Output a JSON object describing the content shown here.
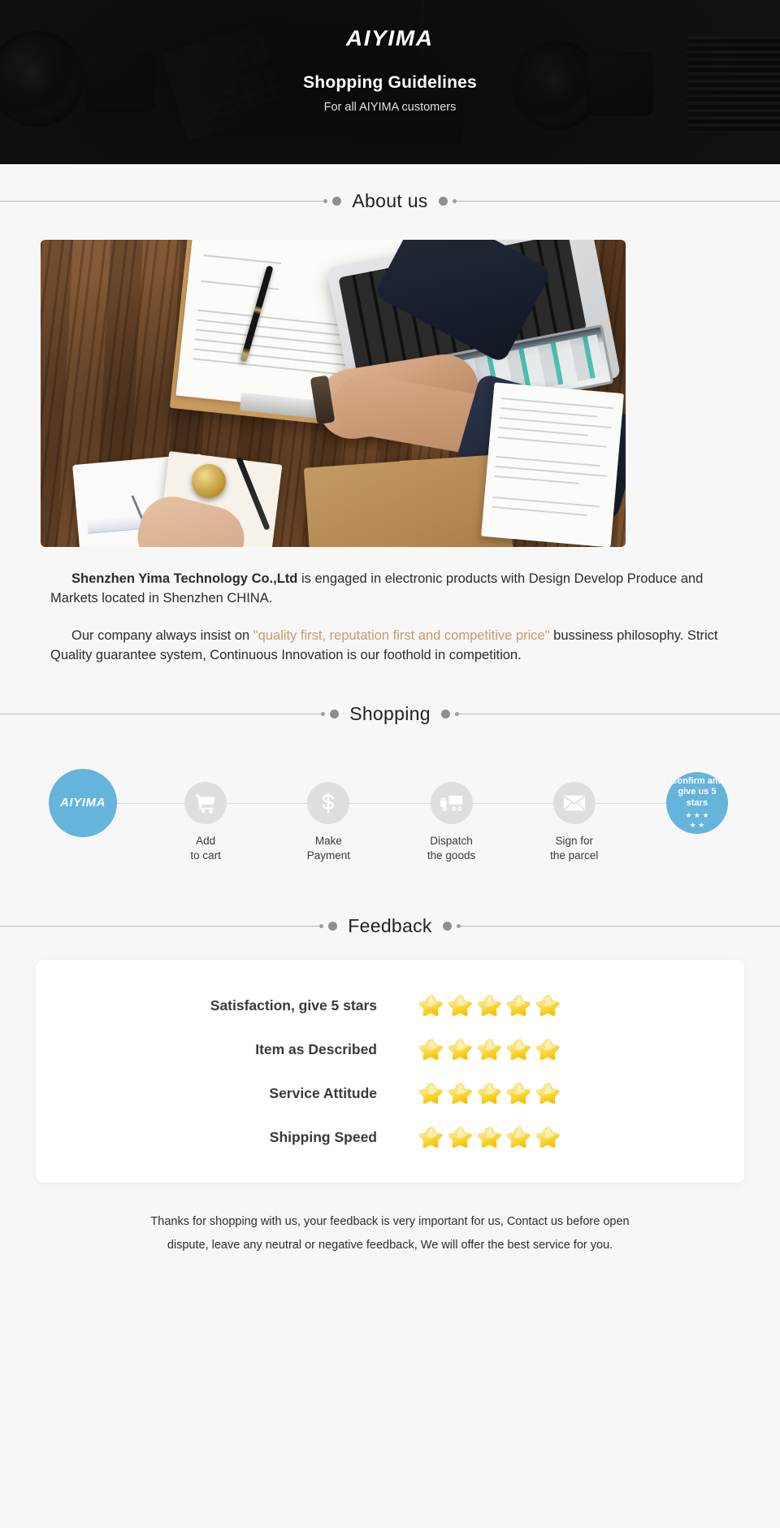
{
  "hero": {
    "brand": "AIYIMA",
    "title": "Shopping Guidelines",
    "subtitle": "For all AIYIMA customers"
  },
  "sections": {
    "about_title": "About us",
    "shopping_title": "Shopping",
    "feedback_title": "Feedback"
  },
  "about": {
    "para1_lead": "Shenzhen Yima Technology Co.,Ltd",
    "para1_rest": " is engaged in electronic products with Design Develop Produce and Markets located in Shenzhen CHINA.",
    "para2_start": "Our company always insist on ",
    "para2_quote": "\"quality first, reputation first and competitive price\"",
    "para2_end": " bussiness philosophy. Strict Quality guarantee system, Continuous Innovation is our foothold in competition."
  },
  "shopping": {
    "steps": [
      {
        "icon": "aiyima-logo-icon",
        "logo": "AIYIMA",
        "label_line1": "",
        "label_line2": "",
        "style": "brand"
      },
      {
        "icon": "shopping-cart-icon",
        "label_line1": "Add",
        "label_line2": "to cart",
        "style": "grey"
      },
      {
        "icon": "dollar-icon",
        "label_line1": "Make",
        "label_line2": "Payment",
        "style": "grey"
      },
      {
        "icon": "truck-icon",
        "label_line1": "Dispatch",
        "label_line2": "the goods",
        "style": "grey"
      },
      {
        "icon": "envelope-icon",
        "label_line1": "Sign for",
        "label_line2": "the parcel",
        "style": "grey"
      },
      {
        "icon": "five-star-icon",
        "confirm_line1": "Confirm and",
        "confirm_line2": "give us 5 stars",
        "stars_top": "★ ★ ★",
        "stars_bottom": "★ ★",
        "style": "confirm"
      }
    ]
  },
  "feedback": {
    "rows": [
      {
        "label": "Satisfaction, give 5 stars",
        "stars": 5
      },
      {
        "label": "Item as Described",
        "stars": 5
      },
      {
        "label": "Service Attitude",
        "stars": 5
      },
      {
        "label": "Shipping Speed",
        "stars": 5
      }
    ]
  },
  "footer": {
    "note_line1": "Thanks for shopping with us, your feedback is very important for us, Contact us before open",
    "note_line2": "dispute, leave any neutral or negative feedback, We will offer the best service for you."
  },
  "colors": {
    "hero_bg": "#121212",
    "page_bg": "#f7f7f7",
    "accent_blue": "#64b4dc",
    "quote_brown": "#c89b6d",
    "star_yellow": "#ffd83d",
    "circle_grey": "#dedede"
  }
}
